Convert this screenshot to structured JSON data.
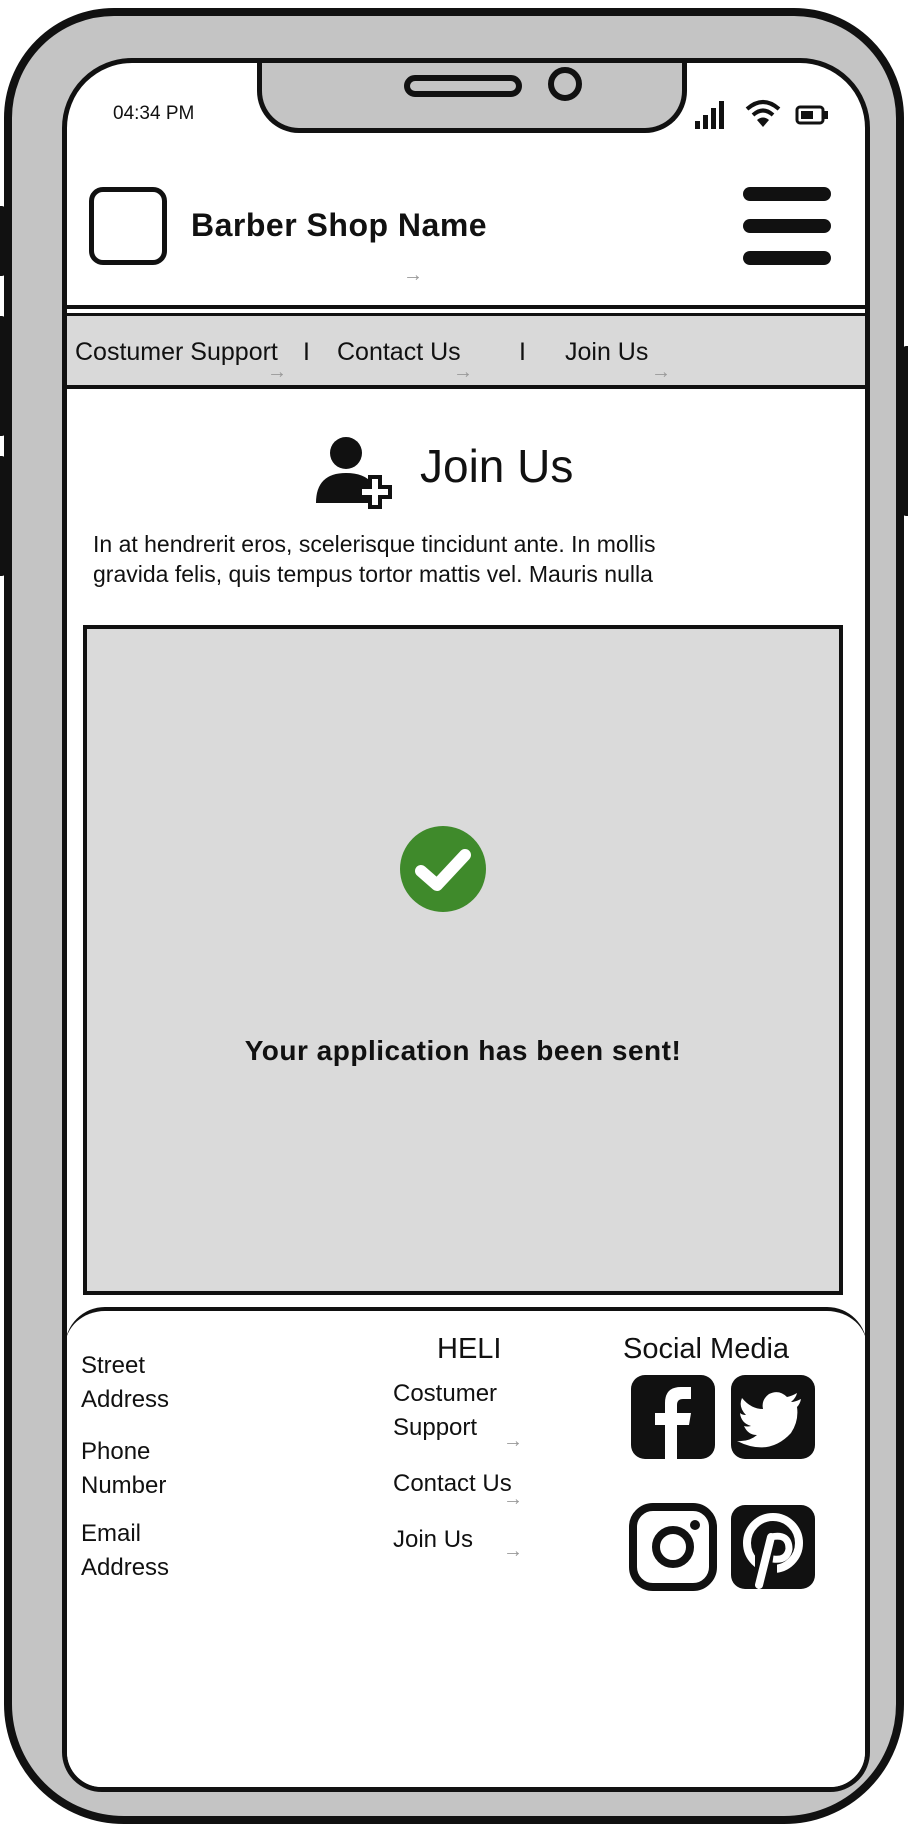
{
  "status_bar": {
    "time": "04:34 PM",
    "signal_icon": "signal-icon",
    "wifi_icon": "wifi-icon",
    "battery_icon": "battery-icon"
  },
  "header": {
    "logo_icon": "logo-placeholder-icon",
    "shop_name": "Barber Shop Name",
    "menu_icon": "hamburger-menu-icon"
  },
  "nav": {
    "items": [
      {
        "label": "Costumer Support"
      },
      {
        "label": "Contact Us"
      },
      {
        "label": "Join Us"
      }
    ],
    "separator": "I"
  },
  "main": {
    "title_icon": "add-user-icon",
    "title": "Join Us",
    "intro_line1": "In at hendrerit eros, scelerisque tincidunt ante. In mollis",
    "intro_line2": "gravida felis, quis tempus tortor mattis vel. Mauris nulla",
    "success_icon": "check-circle-icon",
    "success_message": "Your application has been sent!"
  },
  "footer": {
    "address_lines": [
      "Street",
      "Address"
    ],
    "phone_lines": [
      "Phone",
      "Number"
    ],
    "email_lines": [
      "Email",
      "Address"
    ],
    "help_heading": "HELI",
    "help_links": [
      {
        "label_line1": "Costumer",
        "label_line2": "Support"
      },
      {
        "label_line1": "Contact Us",
        "label_line2": ""
      },
      {
        "label_line1": "Join Us",
        "label_line2": ""
      }
    ],
    "social_heading": "Social Media",
    "social_icons": [
      "facebook-icon",
      "twitter-icon",
      "instagram-icon",
      "pinterest-icon"
    ]
  },
  "colors": {
    "frame": "#c4c4c4",
    "panel": "#dadada",
    "success_green": "#3f8a2b",
    "ink": "#111111"
  }
}
